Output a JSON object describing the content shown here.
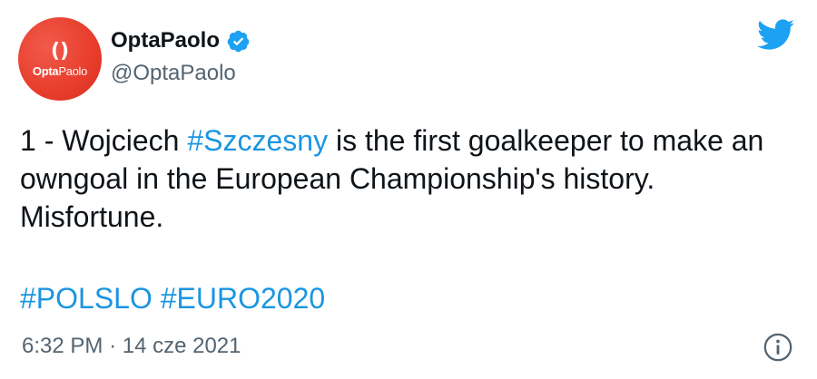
{
  "author": {
    "display_name": "OptaPaolo",
    "handle": "@OptaPaolo",
    "avatar_logo_bold": "Opta",
    "avatar_logo_regular": "Paolo",
    "avatar_color": "#e83d2c",
    "verified": true
  },
  "tweet": {
    "text_prefix": "1 - Wojciech ",
    "mention_hashtag": "#Szczesny",
    "text_suffix": " is the first goalkeeper to make an owngoal in the European Championship's history. Misfortune.",
    "hashtags": [
      "#POLSLO",
      "#EURO2020"
    ],
    "time": "6:32 PM",
    "separator": "·",
    "date": "14 cze 2021"
  },
  "icons": {
    "brand": "twitter-bird-icon",
    "verified": "verified-badge-icon",
    "info": "info-icon"
  },
  "colors": {
    "link": "#1b95e0",
    "twitter_blue": "#1da1f2",
    "muted": "#536471"
  }
}
